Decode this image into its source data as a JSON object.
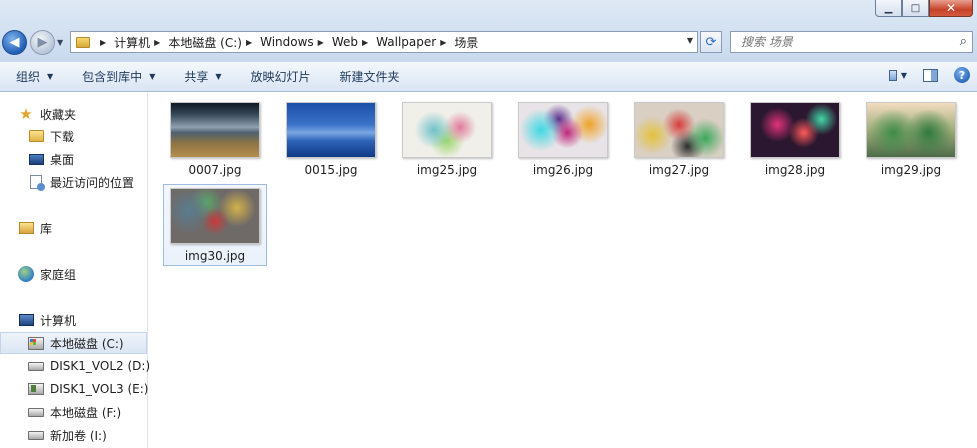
{
  "window": {
    "controls": {
      "minimize": "▁",
      "maximize": "□",
      "close": "✕"
    }
  },
  "address": {
    "crumbs": [
      "计算机",
      "本地磁盘 (C:)",
      "Windows",
      "Web",
      "Wallpaper",
      "场景"
    ]
  },
  "search": {
    "placeholder": "搜索 场景"
  },
  "toolbar": {
    "items": [
      "组织",
      "包含到库中",
      "共享",
      "放映幻灯片",
      "新建文件夹"
    ]
  },
  "nav": {
    "favorites": {
      "label": "收藏夹",
      "items": [
        "下载",
        "桌面",
        "最近访问的位置"
      ]
    },
    "libraries": {
      "label": "库"
    },
    "homegroup": {
      "label": "家庭组"
    },
    "computer": {
      "label": "计算机",
      "drives": [
        "本地磁盘 (C:)",
        "DISK1_VOL2 (D:)",
        "DISK1_VOL3 (E:)",
        "本地磁盘 (F:)",
        "新加卷 (I:)"
      ]
    }
  },
  "files": [
    {
      "name": "0007.jpg"
    },
    {
      "name": "0015.jpg"
    },
    {
      "name": "img25.jpg"
    },
    {
      "name": "img26.jpg"
    },
    {
      "name": "img27.jpg"
    },
    {
      "name": "img28.jpg"
    },
    {
      "name": "img29.jpg"
    },
    {
      "name": "img30.jpg"
    }
  ],
  "colors": {
    "accent": "#1f5fb5",
    "selection_border": "#9fbbe0",
    "toolbar_text": "#1e395b"
  }
}
